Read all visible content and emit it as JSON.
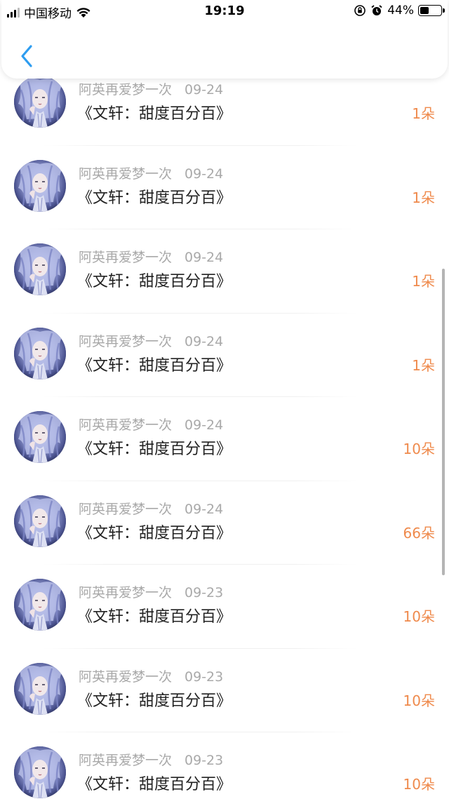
{
  "status_bar": {
    "carrier": "中国移动",
    "time": "19:19",
    "battery": "44%",
    "battery_level": 0.44,
    "icons": [
      "signal-icon",
      "wifi-icon",
      "orientation-lock-icon",
      "alarm-icon",
      "battery-icon"
    ]
  },
  "header": {
    "back_icon": "chevron-left-icon",
    "accent": "#2e9df0"
  },
  "colors": {
    "meta_text": "#a9a9a9",
    "title_text": "#222222",
    "amount": "#ef8a4c"
  },
  "list": {
    "items": [
      {
        "name": "阿英再爱梦一次",
        "date": "09-24",
        "title": "《文轩：甜度百分百》",
        "amount": "1朵"
      },
      {
        "name": "阿英再爱梦一次",
        "date": "09-24",
        "title": "《文轩：甜度百分百》",
        "amount": "1朵"
      },
      {
        "name": "阿英再爱梦一次",
        "date": "09-24",
        "title": "《文轩：甜度百分百》",
        "amount": "1朵"
      },
      {
        "name": "阿英再爱梦一次",
        "date": "09-24",
        "title": "《文轩：甜度百分百》",
        "amount": "1朵"
      },
      {
        "name": "阿英再爱梦一次",
        "date": "09-24",
        "title": "《文轩：甜度百分百》",
        "amount": "10朵"
      },
      {
        "name": "阿英再爱梦一次",
        "date": "09-24",
        "title": "《文轩：甜度百分百》",
        "amount": "66朵"
      },
      {
        "name": "阿英再爱梦一次",
        "date": "09-23",
        "title": "《文轩：甜度百分百》",
        "amount": "10朵"
      },
      {
        "name": "阿英再爱梦一次",
        "date": "09-23",
        "title": "《文轩：甜度百分百》",
        "amount": "10朵"
      },
      {
        "name": "阿英再爱梦一次",
        "date": "09-23",
        "title": "《文轩：甜度百分百》",
        "amount": "10朵"
      }
    ]
  }
}
